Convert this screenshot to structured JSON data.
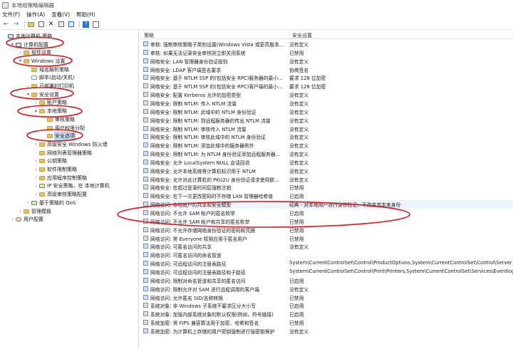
{
  "window": {
    "title": "本地组策略编辑器",
    "menus": [
      "文件(F)",
      "操作(A)",
      "查看(V)",
      "帮助(H)"
    ]
  },
  "toolbar": [
    "back",
    "forward",
    "folder",
    "export",
    "delete",
    "properties",
    "help",
    "filter"
  ],
  "tree": [
    {
      "label": "本地计算机 策略",
      "d": 0,
      "a": "",
      "i": "pc"
    },
    {
      "label": "计算机配置",
      "d": 1,
      "a": "▾",
      "i": "pc"
    },
    {
      "label": "软件设置",
      "d": 2,
      "a": "›",
      "i": "f"
    },
    {
      "label": "Windows 设置",
      "d": 2,
      "a": "▾",
      "i": "f"
    },
    {
      "label": "域名解析策略",
      "d": 3,
      "a": "",
      "i": "f"
    },
    {
      "label": "脚本(启动/关机)",
      "d": 3,
      "a": "",
      "i": "doc"
    },
    {
      "label": "已部署的打印机",
      "d": 3,
      "a": "›",
      "i": "f"
    },
    {
      "label": "安全设置",
      "d": 3,
      "a": "▾",
      "i": "f"
    },
    {
      "label": "帐户策略",
      "d": 4,
      "a": "›",
      "i": "f"
    },
    {
      "label": "本地策略",
      "d": 4,
      "a": "▾",
      "i": "f"
    },
    {
      "label": "审核策略",
      "d": 5,
      "a": "",
      "i": "f"
    },
    {
      "label": "用户权限分配",
      "d": 5,
      "a": "",
      "i": "f"
    },
    {
      "label": "安全选项",
      "d": 5,
      "a": "",
      "i": "f",
      "sel": true
    },
    {
      "label": "高级安全 Windows 防火墙",
      "d": 4,
      "a": "›",
      "i": "f"
    },
    {
      "label": "网络列表管理器策略",
      "d": 4,
      "a": "",
      "i": "f"
    },
    {
      "label": "公钥策略",
      "d": 4,
      "a": "›",
      "i": "f"
    },
    {
      "label": "软件限制策略",
      "d": 4,
      "a": "›",
      "i": "f"
    },
    {
      "label": "应用程序控制策略",
      "d": 4,
      "a": "›",
      "i": "f"
    },
    {
      "label": "IP 安全策略，在 本地计算机",
      "d": 4,
      "a": "›",
      "i": "pol"
    },
    {
      "label": "高级审核策略配置",
      "d": 4,
      "a": "›",
      "i": "f"
    },
    {
      "label": "基于策略的 QoS",
      "d": 3,
      "a": "›",
      "i": "pol"
    },
    {
      "label": "管理模板",
      "d": 2,
      "a": "›",
      "i": "f"
    },
    {
      "label": "用户配置",
      "d": 1,
      "a": "›",
      "i": "user"
    }
  ],
  "list": {
    "col_policy": "策略",
    "col_setting": "安全设置",
    "rows": [
      {
        "p": "审核: 强制审核策略子类别设置(Windows Vista 或更高版本...",
        "v": "没有定义"
      },
      {
        "p": "审核: 如果无法记录安全审核则立即关闭系统",
        "v": "已禁用"
      },
      {
        "p": "网络安全: LAN 管理器身份验证级别",
        "v": "没有定义"
      },
      {
        "p": "网络安全: LDAP 客户端签名要求",
        "v": "协商签名"
      },
      {
        "p": "网络安全: 基于 NTLM SSP 的(包括安全 RPC)服务器的最小...",
        "v": "要求 128 位加密"
      },
      {
        "p": "网络安全: 基于 NTLM SSP 的(包括安全 RPC)客户端的最小...",
        "v": "要求 128 位加密"
      },
      {
        "p": "网络安全: 配置 Kerberos 允许的加密类型",
        "v": "没有定义"
      },
      {
        "p": "网络安全: 限制 NTLM: 传入 NTLM 流量",
        "v": "没有定义"
      },
      {
        "p": "网络安全: 限制 NTLM: 此域中的 NTLM 身份验证",
        "v": "没有定义"
      },
      {
        "p": "网络安全: 限制 NTLM: 到远程服务器的传出 NTLM 流量",
        "v": "没有定义"
      },
      {
        "p": "网络安全: 限制 NTLM: 审核传入 NTLM 流量",
        "v": "没有定义"
      },
      {
        "p": "网络安全: 限制 NTLM: 审核此域中的 NTLM 身份验证",
        "v": "没有定义"
      },
      {
        "p": "网络安全: 限制 NTLM: 添加此域中的服务器例外",
        "v": "没有定义"
      },
      {
        "p": "网络安全: 限制 NTLM: 为 NTLM 身份验证添加远程服务器...",
        "v": "没有定义"
      },
      {
        "p": "网络安全: 允许 LocalSystem NULL 会话回退",
        "v": "没有定义"
      },
      {
        "p": "网络安全: 允许本地系统将计算机标识用于 NTLM",
        "v": "没有定义"
      },
      {
        "p": "网络安全: 允许对此计算机的 PKU2U 身份验证请求使用联...",
        "v": "没有定义"
      },
      {
        "p": "网络安全: 在超过登录时间后强制注销",
        "v": "已禁用"
      },
      {
        "p": "网络安全: 在下一次更改密码时不存储 LAN 管理器哈希值",
        "v": "已启用"
      },
      {
        "p": "网络访问: 本地帐户的共享和安全模型",
        "v": "经典 - 对本地用户进行身份验证，不改变其本来身份",
        "sel": true
      },
      {
        "p": "网络访问: 不允许 SAM 帐户的匿名枚举",
        "v": "已启用"
      },
      {
        "p": "网络访问: 不允许 SAM 帐户和共享的匿名枚举",
        "v": "已禁用"
      },
      {
        "p": "网络访问: 不允许存储网络身份验证的密码和凭据",
        "v": "已禁用"
      },
      {
        "p": "网络访问: 将 Everyone 权限应用于匿名用户",
        "v": "已禁用"
      },
      {
        "p": "网络访问: 可匿名访问的共享",
        "v": "没有定义"
      },
      {
        "p": "网络访问: 可匿名访问的命名管道",
        "v": ""
      },
      {
        "p": "网络访问: 可远程访问的注册表路径",
        "v": "System\\CurrentControlSet\\Control\\ProductOptions,System\\CurrentControlSet\\Control\\Server"
      },
      {
        "p": "网络访问: 可远程访问的注册表路径和子路径",
        "v": "System\\CurrentControlSet\\Control\\Print\\Printers,System\\CurrentControlSet\\Services\\Eventlog"
      },
      {
        "p": "网络访问: 限制对命名管道和共享的匿名访问",
        "v": "已启用"
      },
      {
        "p": "网络访问: 限制允许对 SAM 进行远程调用的客户端",
        "v": "没有定义"
      },
      {
        "p": "网络访问: 允许匿名 SID/名称转换",
        "v": "已禁用"
      },
      {
        "p": "系统对象: 非 Windows 子系统不要求区分大小写",
        "v": "已启用"
      },
      {
        "p": "系统对象: 加强内部系统对象的默认权限(例如，符号链接)",
        "v": "已启用"
      },
      {
        "p": "系统加密: 将 FIPS 兼容算法用于加密、哈希和签名",
        "v": "已禁用"
      },
      {
        "p": "系统加密: 为计算机上存储的用户密钥强制进行强密钥保护",
        "v": "没有定义"
      }
    ]
  }
}
